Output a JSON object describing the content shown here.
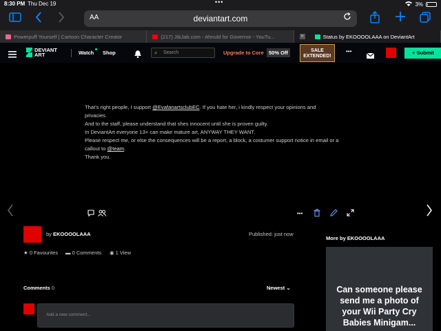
{
  "status_bar": {
    "time": "8:30 PM",
    "date": "Thu Dec 19",
    "battery": "3%"
  },
  "browser": {
    "aa_label": "AA",
    "url": "deviantart.com",
    "tabs": [
      {
        "label": "Powerpuff Yourself | Cartoon Character Creator",
        "favicon_color": "#e86a8f"
      },
      {
        "label": "(217) JibJab.com - Ahnuld for Governor - YouTu...",
        "favicon_color": "#ff0000"
      },
      {
        "label": "Status by EKOOOOLAAA on DeviantArt",
        "favicon_color": "#00e59b"
      }
    ]
  },
  "da_nav": {
    "logo_line1": "DEVIANT",
    "logo_line2": "ART",
    "watch": "Watch",
    "shop": "Shop",
    "search_placeholder": "Search",
    "upgrade": "Upgrade to Core",
    "discount": "50% Off",
    "sale_line1": "SALE",
    "sale_line2": "EXTENDED!",
    "more": "•••",
    "submit": "Submit"
  },
  "deviation": {
    "description": {
      "l1_pre": "That's right people, I support ",
      "l1_mention": "@EvafanartsclubEC",
      "l1_post": ". If you hate her, i kindly respect your opinions and",
      "l2": "privacies.",
      "l3": "And to the staff, please understand that shes innocent until she is proven guilty.",
      "l4": "In DeviantArt everyone 13+ can make mature art, ANYWAY THEY WANT.",
      "l5": "Please respect me, or else the consequences will be a report, a block, a costumer support notice in email or a",
      "l6_pre": "callout to ",
      "l6_mention": "@team",
      "l6_post": ".",
      "l7": "Thank you."
    },
    "by_label": "by",
    "author": "EKOOOOLAAA",
    "published": "Published: just now",
    "favourites": "0 Favourites",
    "comments": "0 Comments",
    "views": "1 View"
  },
  "comments": {
    "title": "Comments",
    "count": "0",
    "sort": "Newest",
    "placeholder": "Add a new comment..."
  },
  "more_by": {
    "title": "More by EKOOOOLAAA",
    "card_text": "Can someone please send me a photo of your Wii Party Cry Babies Minigam..."
  },
  "colors": {
    "accent_green": "#00e59b",
    "upgrade_orange": "#f07e57",
    "avatar_red": "#e00000",
    "safari_blue": "#0a84ff"
  }
}
